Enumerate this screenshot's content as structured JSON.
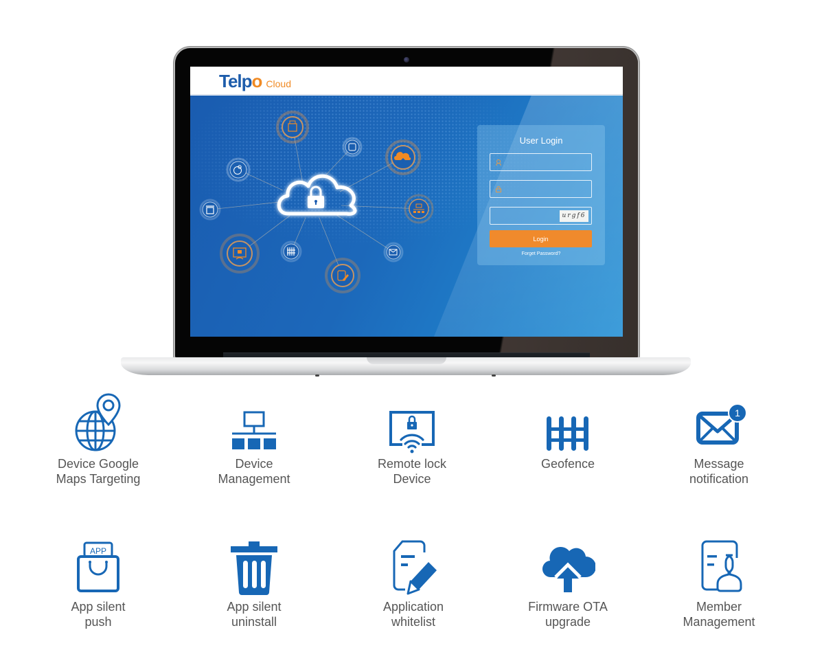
{
  "app": {
    "brand_main": "Telp",
    "brand_o": "o",
    "brand_suffix": "Cloud"
  },
  "login": {
    "title": "User Login",
    "username_placeholder": "",
    "password_placeholder": "",
    "captcha_placeholder": "",
    "captcha_text": "urgf6",
    "login_label": "Login",
    "forgot_label": "Forget Password?"
  },
  "hero": {
    "center_icon": "cloud-lock-icon",
    "nodes": [
      {
        "icon": "app-bag-icon",
        "accent": "#f08a24"
      },
      {
        "icon": "member-icon",
        "accent": "#ffffff"
      },
      {
        "icon": "cloud-upload-icon",
        "accent": "#f08a24"
      },
      {
        "icon": "globe-pin-icon",
        "accent": "#ffffff"
      },
      {
        "icon": "trash-icon",
        "accent": "#ffffff"
      },
      {
        "icon": "network-icon",
        "accent": "#f08a24"
      },
      {
        "icon": "remote-lock-icon",
        "accent": "#f08a24"
      },
      {
        "icon": "fence-icon",
        "accent": "#ffffff"
      },
      {
        "icon": "message-icon",
        "accent": "#ffffff"
      },
      {
        "icon": "whitelist-icon",
        "accent": "#f08a24"
      }
    ]
  },
  "colors": {
    "icon_blue": "#1767b5",
    "login_orange": "#f08a2c",
    "brand_blue": "#1e5dab",
    "label_gray": "#555555"
  },
  "features": [
    {
      "label": "Device Google\nMaps Targeting",
      "icon": "globe-pin-icon"
    },
    {
      "label": "Device\nManagement",
      "icon": "network-icon"
    },
    {
      "label": "Remote lock\nDevice",
      "icon": "remote-lock-icon"
    },
    {
      "label": "Geofence",
      "icon": "fence-icon"
    },
    {
      "label": "Message\nnotification",
      "icon": "message-icon",
      "badge": "1"
    },
    {
      "label": "App silent\npush",
      "icon": "app-bag-icon",
      "icon_text": "APP"
    },
    {
      "label": "App silent\nuninstall",
      "icon": "trash-icon"
    },
    {
      "label": "Application\nwhitelist",
      "icon": "whitelist-icon"
    },
    {
      "label": "Firmware OTA\nupgrade",
      "icon": "cloud-upload-icon"
    },
    {
      "label": "Member\nManagement",
      "icon": "member-icon"
    }
  ]
}
